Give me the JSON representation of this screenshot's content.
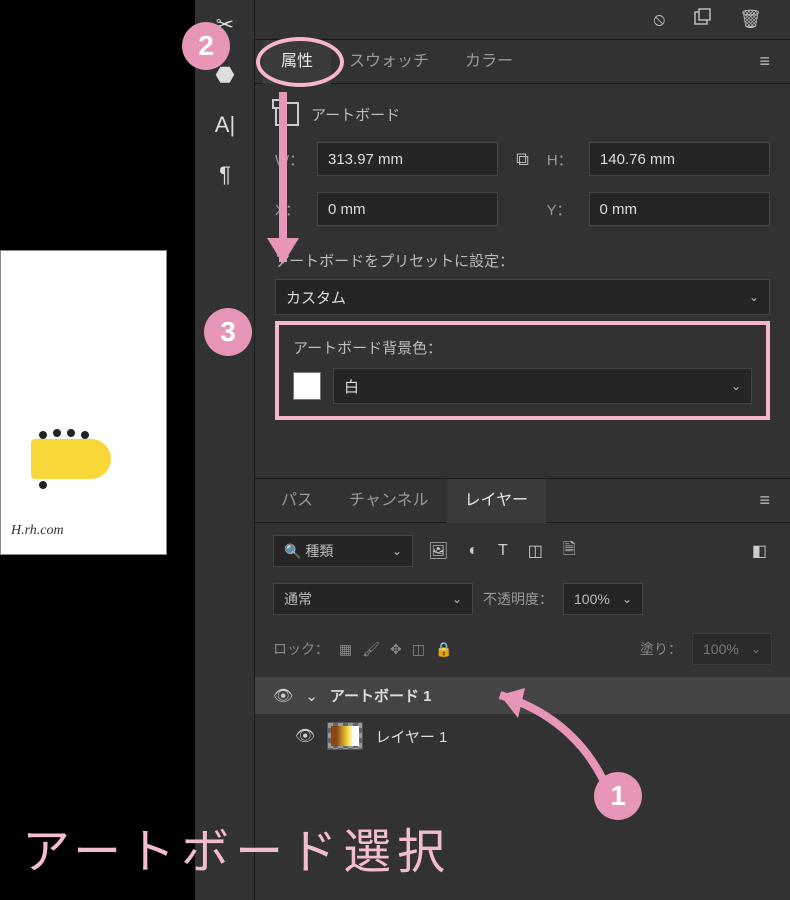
{
  "topbar": {
    "icons": [
      "⦸",
      "⬚",
      "🗑"
    ]
  },
  "tabs_top": {
    "items": [
      "属性",
      "スウォッチ",
      "カラー"
    ],
    "active": 0
  },
  "attributes": {
    "artboard_label": "アートボード",
    "w_label": "W：",
    "w_value": "313.97 mm",
    "h_label": "H：",
    "h_value": "140.76 mm",
    "x_label": "X：",
    "x_value": "0 mm",
    "y_label": "Y：",
    "y_value": "0 mm",
    "preset_label": "アートボードをプリセットに設定：",
    "preset_value": "カスタム",
    "bg_label": "アートボード背景色：",
    "bg_value": "白"
  },
  "layers": {
    "tabs": {
      "items": [
        "パス",
        "チャンネル",
        "レイヤー"
      ],
      "active": 2
    },
    "search_label": "種類",
    "blend_mode": "通常",
    "opacity_label": "不透明度：",
    "opacity_value": "100%",
    "lock_label": "ロック：",
    "fill_label": "塗り：",
    "fill_value": "100%",
    "items": [
      {
        "name": "アートボード 1",
        "type": "artboard",
        "selected": true
      },
      {
        "name": "レイヤー 1",
        "type": "layer",
        "selected": false
      }
    ]
  },
  "annotations": {
    "n1": "1",
    "n2": "2",
    "n3": "3",
    "big": "アートボード選択"
  },
  "watermark": "H.rh.com"
}
